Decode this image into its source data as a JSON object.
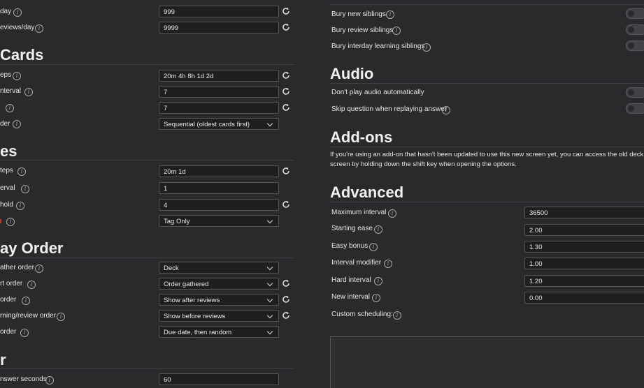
{
  "left": {
    "top_fields": [
      {
        "label": "day",
        "value": "999"
      },
      {
        "label": "eviews/day",
        "value": "9999"
      }
    ],
    "sections": {
      "new_cards": {
        "title": "Cards",
        "fields": [
          {
            "label": "eps",
            "value": "20m 4h 8h 1d 2d"
          },
          {
            "label": "nterval",
            "value": "7"
          },
          {
            "label": "",
            "value": "7"
          },
          {
            "label": "der",
            "value": "Sequential (oldest cards first)"
          }
        ]
      },
      "lapses": {
        "title": "es",
        "fields": [
          {
            "label": "teps",
            "value": "20m 1d"
          },
          {
            "label": "erval",
            "value": "1"
          },
          {
            "label": "hold",
            "value": "4"
          },
          {
            "label": "",
            "value": "Tag Only"
          }
        ]
      },
      "display_order": {
        "title": "ay Order",
        "fields": [
          {
            "label": "ather order",
            "value": "Deck"
          },
          {
            "label": "rt order",
            "value": "Order gathered"
          },
          {
            "label": "order",
            "value": "Show after reviews"
          },
          {
            "label": "rning/review order",
            "value": "Show before reviews"
          },
          {
            "label": "order",
            "value": "Due date, then random"
          }
        ]
      },
      "timer": {
        "title": "r",
        "fields": [
          {
            "label": "nswer seconds",
            "value": "60"
          }
        ]
      }
    }
  },
  "right": {
    "burying": {
      "items": [
        {
          "label": "Bury new siblings"
        },
        {
          "label": "Bury review siblings"
        },
        {
          "label": "Bury interday learning siblings"
        }
      ]
    },
    "audio": {
      "title": "Audio",
      "items": [
        {
          "label": "Don't play audio automatically"
        },
        {
          "label": "Skip question when replaying answer"
        }
      ]
    },
    "addons": {
      "title": "Add-ons",
      "text_line1": "If you're using an add-on that hasn't been updated to use this new screen yet, you can access the old deck optio",
      "text_line2": "screen by holding down the shift key when opening the options."
    },
    "advanced": {
      "title": "Advanced",
      "fields": [
        {
          "label": "Maximum interval",
          "value": "36500"
        },
        {
          "label": "Starting ease",
          "value": "2.00"
        },
        {
          "label": "Easy bonus",
          "value": "1.30"
        },
        {
          "label": "Interval modifier",
          "value": "1.00"
        },
        {
          "label": "Hard interval",
          "value": "1.20"
        },
        {
          "label": "New interval",
          "value": "0.00"
        }
      ],
      "custom_label": "Custom scheduling:"
    }
  },
  "icons": {
    "info": "info-icon",
    "reset": "reset-icon",
    "chevron": "chevron-down-icon",
    "toggle": "toggle-switch"
  },
  "colors": {
    "background": "#2a2a2c",
    "input_bg": "#1f1f21",
    "border": "#555555",
    "text": "#e6e6e6"
  }
}
